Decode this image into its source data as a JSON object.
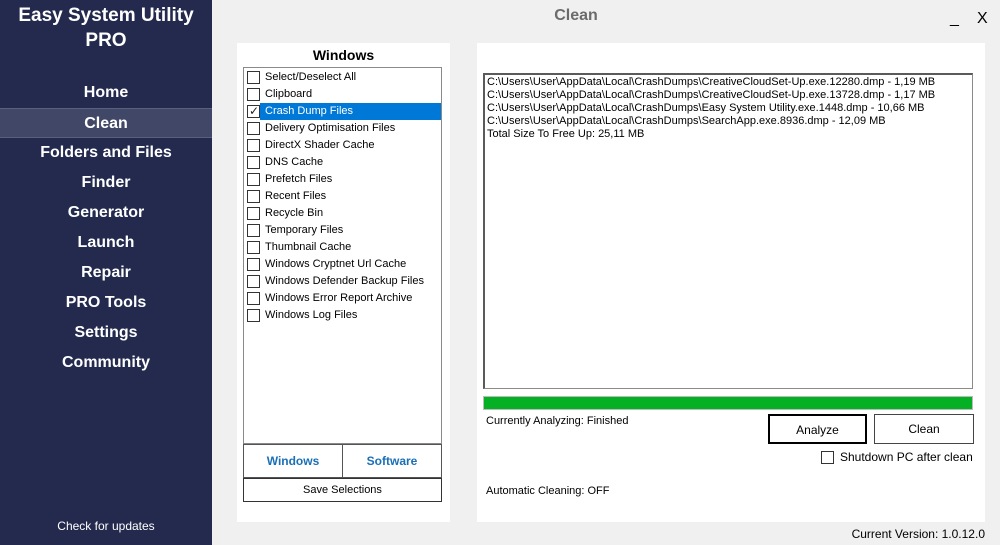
{
  "app": {
    "title_line1": "Easy System Utility",
    "title_line2": "PRO"
  },
  "nav": [
    {
      "label": "Home",
      "active": false
    },
    {
      "label": "Clean",
      "active": true
    },
    {
      "label": "Folders and Files",
      "active": false
    },
    {
      "label": "Finder",
      "active": false
    },
    {
      "label": "Generator",
      "active": false
    },
    {
      "label": "Launch",
      "active": false
    },
    {
      "label": "Repair",
      "active": false
    },
    {
      "label": "PRO Tools",
      "active": false
    },
    {
      "label": "Settings",
      "active": false
    },
    {
      "label": "Community",
      "active": false
    }
  ],
  "check_updates": "Check for updates",
  "header": {
    "title": "Clean",
    "minimize": "_",
    "close": "X"
  },
  "left_panel": {
    "heading": "Windows",
    "items": [
      {
        "label": "Select/Deselect All",
        "checked": false,
        "selected": false
      },
      {
        "label": "Clipboard",
        "checked": false,
        "selected": false
      },
      {
        "label": "Crash Dump Files",
        "checked": true,
        "selected": true
      },
      {
        "label": "Delivery Optimisation Files",
        "checked": false,
        "selected": false
      },
      {
        "label": "DirectX Shader Cache",
        "checked": false,
        "selected": false
      },
      {
        "label": "DNS Cache",
        "checked": false,
        "selected": false
      },
      {
        "label": "Prefetch Files",
        "checked": false,
        "selected": false
      },
      {
        "label": "Recent Files",
        "checked": false,
        "selected": false
      },
      {
        "label": "Recycle Bin",
        "checked": false,
        "selected": false
      },
      {
        "label": "Temporary Files",
        "checked": false,
        "selected": false
      },
      {
        "label": "Thumbnail Cache",
        "checked": false,
        "selected": false
      },
      {
        "label": "Windows Cryptnet Url Cache",
        "checked": false,
        "selected": false
      },
      {
        "label": "Windows Defender Backup Files",
        "checked": false,
        "selected": false
      },
      {
        "label": "Windows Error Report Archive",
        "checked": false,
        "selected": false
      },
      {
        "label": "Windows Log Files",
        "checked": false,
        "selected": false
      }
    ],
    "tab_windows": "Windows",
    "tab_software": "Software",
    "save_selections": "Save Selections"
  },
  "right_panel": {
    "output_lines": [
      "C:\\Users\\User\\AppData\\Local\\CrashDumps\\CreativeCloudSet-Up.exe.12280.dmp - 1,19 MB",
      "C:\\Users\\User\\AppData\\Local\\CrashDumps\\CreativeCloudSet-Up.exe.13728.dmp - 1,17 MB",
      "C:\\Users\\User\\AppData\\Local\\CrashDumps\\Easy System Utility.exe.1448.dmp - 10,66 MB",
      "C:\\Users\\User\\AppData\\Local\\CrashDumps\\SearchApp.exe.8936.dmp - 12,09 MB",
      "Total Size To Free Up: 25,11 MB"
    ],
    "progress": 1.0,
    "status": "Currently Analyzing: Finished",
    "analyze_label": "Analyze",
    "clean_label": "Clean",
    "shutdown_label": "Shutdown PC after clean",
    "shutdown_checked": false,
    "auto_cleaning": "Automatic Cleaning: OFF"
  },
  "version": "Current Version: 1.0.12.0",
  "colors": {
    "sidebar_bg": "#232a4e",
    "selected_item": "#0078d7",
    "progress_fill": "#06b025",
    "tab_text": "#1a6fb5"
  }
}
